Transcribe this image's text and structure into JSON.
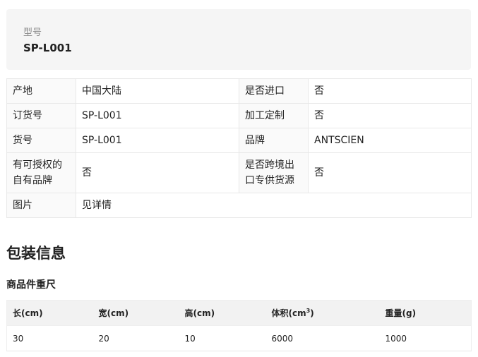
{
  "model": {
    "label": "型号",
    "value": "SP-L001"
  },
  "attributes": {
    "origin_label": "产地",
    "origin_value": "中国大陆",
    "import_label": "是否进口",
    "import_value": "否",
    "order_no_label": "订货号",
    "order_no_value": "SP-L001",
    "custom_label": "加工定制",
    "custom_value": "否",
    "item_no_label": "货号",
    "item_no_value": "SP-L001",
    "brand_label": "品牌",
    "brand_value": "ANTSCIEN",
    "own_brand_label": "有可授权的自有品牌",
    "own_brand_value": "否",
    "crossborder_label": "是否跨境出口专供货源",
    "crossborder_value": "否",
    "image_label": "图片",
    "image_value": "见详情"
  },
  "packaging": {
    "title": "包装信息",
    "subtitle": "商品件重尺",
    "headers": {
      "length": "长(cm)",
      "width": "宽(cm)",
      "height": "高(cm)",
      "volume_prefix": "体积(cm",
      "volume_sup": "3",
      "volume_suffix": ")",
      "weight": "重量(g)"
    },
    "row": {
      "length": "30",
      "width": "20",
      "height": "10",
      "volume": "6000",
      "weight": "1000"
    }
  }
}
